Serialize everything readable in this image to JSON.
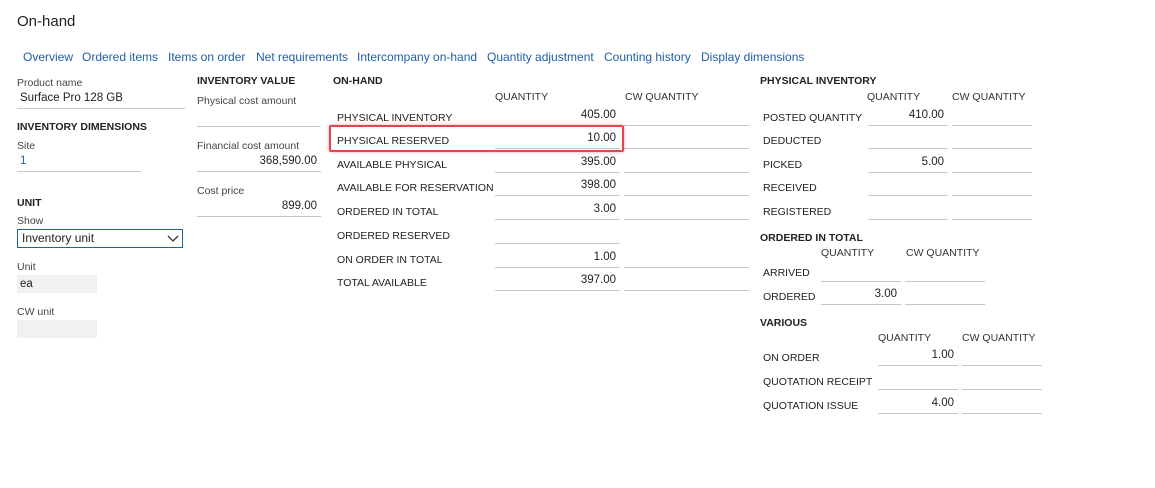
{
  "page": {
    "title": "On-hand"
  },
  "tabs": [
    {
      "label": "Overview"
    },
    {
      "label": "Ordered items"
    },
    {
      "label": "Items on order"
    },
    {
      "label": "Net requirements"
    },
    {
      "label": "Intercompany on-hand"
    },
    {
      "label": "Quantity adjustment"
    },
    {
      "label": "Counting history"
    },
    {
      "label": "Display dimensions"
    }
  ],
  "left": {
    "product_name_label": "Product name",
    "product_name_value": "Surface Pro 128 GB",
    "inv_dim_header": "INVENTORY DIMENSIONS",
    "site_label": "Site",
    "site_value": "1",
    "unit_header": "UNIT",
    "show_label": "Show",
    "show_value": "Inventory unit",
    "unit_label": "Unit",
    "unit_value": "ea",
    "cw_unit_label": "CW unit",
    "cw_unit_value": ""
  },
  "inventory_value": {
    "header": "INVENTORY VALUE",
    "physical_cost_label": "Physical cost amount",
    "physical_cost_value": "",
    "financial_cost_label": "Financial cost amount",
    "financial_cost_value": "368,590.00",
    "cost_price_label": "Cost price",
    "cost_price_value": "899.00"
  },
  "on_hand": {
    "header": "ON-HAND",
    "col_quantity": "QUANTITY",
    "col_cw": "CW QUANTITY",
    "rows": [
      {
        "label": "PHYSICAL INVENTORY",
        "qty": "405.00",
        "cw": ""
      },
      {
        "label": "PHYSICAL RESERVED",
        "qty": "10.00",
        "cw": ""
      },
      {
        "label": "AVAILABLE PHYSICAL",
        "qty": "395.00",
        "cw": ""
      },
      {
        "label": "AVAILABLE FOR RESERVATION",
        "qty": "398.00",
        "cw": ""
      },
      {
        "label": "ORDERED IN TOTAL",
        "qty": "3.00",
        "cw": ""
      },
      {
        "label": "ORDERED RESERVED",
        "qty": "",
        "cw": ""
      },
      {
        "label": "ON ORDER IN TOTAL",
        "qty": "1.00",
        "cw": ""
      },
      {
        "label": "TOTAL AVAILABLE",
        "qty": "397.00",
        "cw": ""
      }
    ]
  },
  "physical_inventory": {
    "header": "PHYSICAL INVENTORY",
    "col_quantity": "QUANTITY",
    "col_cw": "CW QUANTITY",
    "rows": [
      {
        "label": "POSTED QUANTITY",
        "qty": "410.00",
        "cw": ""
      },
      {
        "label": "DEDUCTED",
        "qty": "",
        "cw": ""
      },
      {
        "label": "PICKED",
        "qty": "5.00",
        "cw": ""
      },
      {
        "label": "RECEIVED",
        "qty": "",
        "cw": ""
      },
      {
        "label": "REGISTERED",
        "qty": "",
        "cw": ""
      }
    ]
  },
  "ordered_in_total": {
    "header": "ORDERED IN TOTAL",
    "col_quantity": "QUANTITY",
    "col_cw": "CW QUANTITY",
    "rows": [
      {
        "label": "ARRIVED",
        "qty": "",
        "cw": ""
      },
      {
        "label": "ORDERED",
        "qty": "3.00",
        "cw": ""
      }
    ]
  },
  "various": {
    "header": "VARIOUS",
    "col_quantity": "QUANTITY",
    "col_cw": "CW QUANTITY",
    "rows": [
      {
        "label": "ON ORDER",
        "qty": "1.00",
        "cw": ""
      },
      {
        "label": "QUOTATION RECEIPT",
        "qty": "",
        "cw": ""
      },
      {
        "label": "QUOTATION ISSUE",
        "qty": "4.00",
        "cw": ""
      }
    ]
  },
  "colors": {
    "link": "#1f5fa8",
    "highlight": "#e0474c",
    "field_line": "#c6c6c6"
  }
}
